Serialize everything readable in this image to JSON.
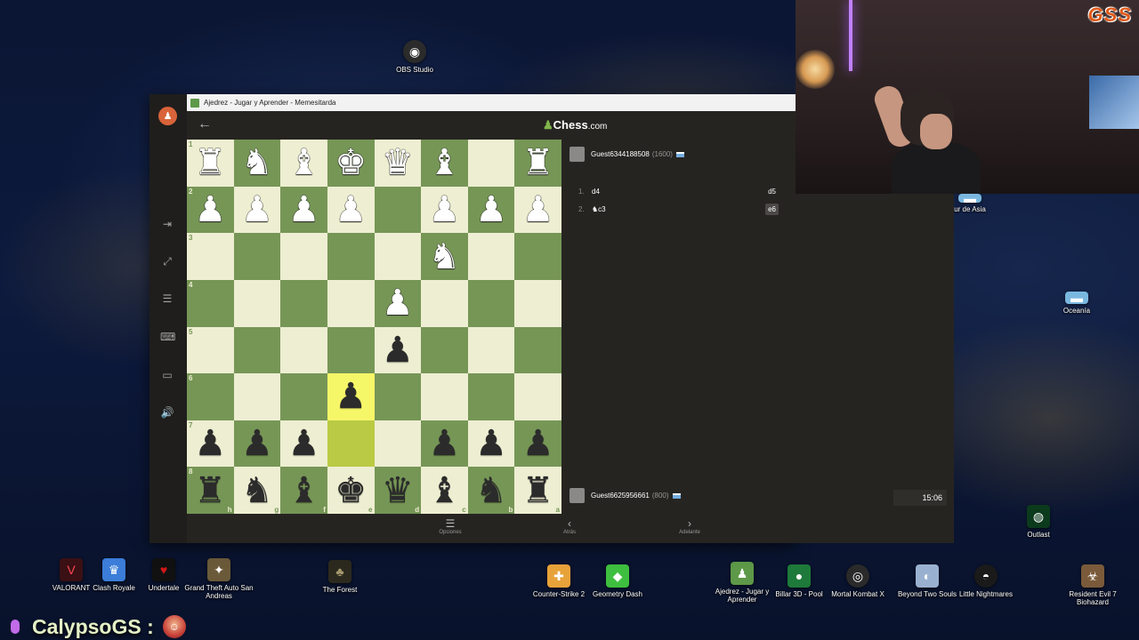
{
  "window": {
    "title": "Ajedrez - Jugar y Aprender - Memesitarda"
  },
  "app": {
    "logo_main": "Chess",
    "logo_tld": ".com",
    "back_icon": "←",
    "side_icons": [
      "⇥",
      "⤢",
      "☰",
      "⌨",
      "▭",
      "🔊"
    ]
  },
  "board": {
    "orientation": "black-bottom",
    "rows": [
      [
        "wR",
        "wN",
        "wB",
        "wK",
        "wQ",
        "wB",
        "",
        "wR"
      ],
      [
        "wP",
        "wP",
        "wP",
        "wP",
        "",
        "wP",
        "wP",
        "wP"
      ],
      [
        "",
        "",
        "",
        "",
        "",
        "wN",
        "",
        ""
      ],
      [
        "",
        "",
        "",
        "",
        "wP",
        "",
        "",
        ""
      ],
      [
        "",
        "",
        "",
        "",
        "bP",
        "",
        "",
        ""
      ],
      [
        "",
        "",
        "",
        "bP",
        "",
        "",
        "",
        ""
      ],
      [
        "bP",
        "bP",
        "bP",
        "",
        "",
        "bP",
        "bP",
        "bP"
      ],
      [
        "bR",
        "bN",
        "bB",
        "bK",
        "bQ",
        "bB",
        "bN",
        "bR"
      ]
    ],
    "rank_labels": [
      "1",
      "2",
      "3",
      "4",
      "5",
      "6",
      "7",
      "8"
    ],
    "file_labels": [
      "h",
      "g",
      "f",
      "e",
      "d",
      "c",
      "b",
      "a"
    ],
    "highlight": [
      [
        5,
        3
      ],
      [
        6,
        3
      ]
    ]
  },
  "players": {
    "top": {
      "name": "Guest6344188508",
      "rating": "(1600)"
    },
    "bottom": {
      "name": "Guest6625956661",
      "rating": "(800)"
    }
  },
  "moves": [
    {
      "num": "1.",
      "white": "d4",
      "black": "d5",
      "selected": false
    },
    {
      "num": "2.",
      "white": "♞c3",
      "black": "e6",
      "selected": true
    }
  ],
  "clock": "15:06",
  "footer": {
    "options_label": "Opciones",
    "back_label": "Atrás",
    "forward_label": "Adelante"
  },
  "desktop": {
    "icons": [
      {
        "label": "OBS Studio",
        "color": "#2b2b2b",
        "glyph": "◉"
      },
      {
        "label": "VALORANT",
        "color": "#ff4655",
        "glyph": "V"
      },
      {
        "label": "Clash Royale",
        "color": "#3b7dd8",
        "glyph": "♛"
      },
      {
        "label": "Undertale",
        "color": "#d01818",
        "glyph": "♥"
      },
      {
        "label": "Grand Theft Auto San Andreas",
        "color": "#6b5a3a",
        "glyph": "✦"
      },
      {
        "label": "The Forest",
        "color": "#2c2a1e",
        "glyph": "♣"
      },
      {
        "label": "Counter-Strike 2",
        "color": "#e8a23a",
        "glyph": "✚"
      },
      {
        "label": "Geometry Dash",
        "color": "#3fbf3f",
        "glyph": "◆"
      },
      {
        "label": "Ajedrez - Jugar y Aprender",
        "color": "#5d9948",
        "glyph": "♟"
      },
      {
        "label": "Billar 3D - Pool",
        "color": "#1e7a3a",
        "glyph": "●"
      },
      {
        "label": "Mortal Kombat X",
        "color": "#2a2a2a",
        "glyph": "◎"
      },
      {
        "label": "Beyond Two Souls",
        "color": "#9ab0d0",
        "glyph": "◐"
      },
      {
        "label": "Little Nightmares",
        "color": "#1a1a1a",
        "glyph": "◓"
      },
      {
        "label": "Resident Evil 7 Biohazard",
        "color": "#7a5a3a",
        "glyph": "☣"
      },
      {
        "label": "Outlast",
        "color": "#0c3a1c",
        "glyph": "◍"
      },
      {
        "label": "Oceanía",
        "color": "#7ab8e0",
        "glyph": "▬"
      },
      {
        "label": "ur de Asia",
        "color": "#7ab8e0",
        "glyph": "▬"
      }
    ]
  },
  "overlay": {
    "cam_logo": "GSS",
    "chat_name": "CalypsoGS :"
  }
}
